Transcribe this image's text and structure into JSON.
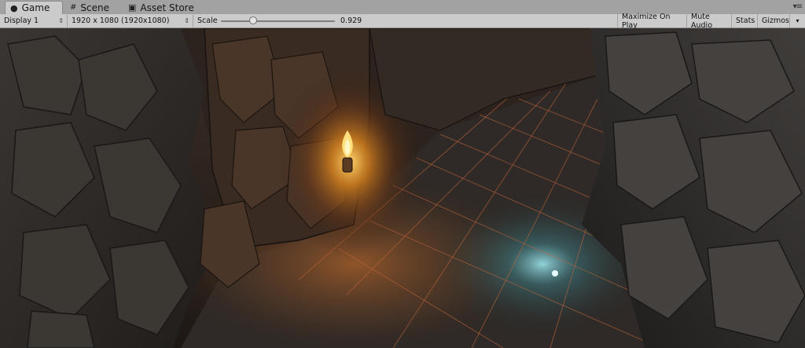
{
  "tabs": [
    {
      "label": "Game",
      "icon": "game-controller-icon",
      "active": true
    },
    {
      "label": "Scene",
      "icon": "scene-icon",
      "active": false
    },
    {
      "label": "Asset Store",
      "icon": "bag-icon",
      "active": false
    }
  ],
  "toolbar": {
    "display_select": "Display 1",
    "resolution_select": "1920 x 1080 (1920x1080)",
    "scale_label": "Scale",
    "scale_value": "0.929",
    "scale_fraction": 0.27,
    "maximize_label": "Maximize On Play",
    "mute_label": "Mute Audio",
    "stats_label": "Stats",
    "gizmos_label": "Gizmos"
  },
  "colors": {
    "tab_active": "#cbcbcb",
    "tab_bar": "#a2a2a2",
    "torch_glow": "#ffb23a",
    "floor_grid": "#c8683a",
    "blue_light": "#7fd3e0"
  }
}
